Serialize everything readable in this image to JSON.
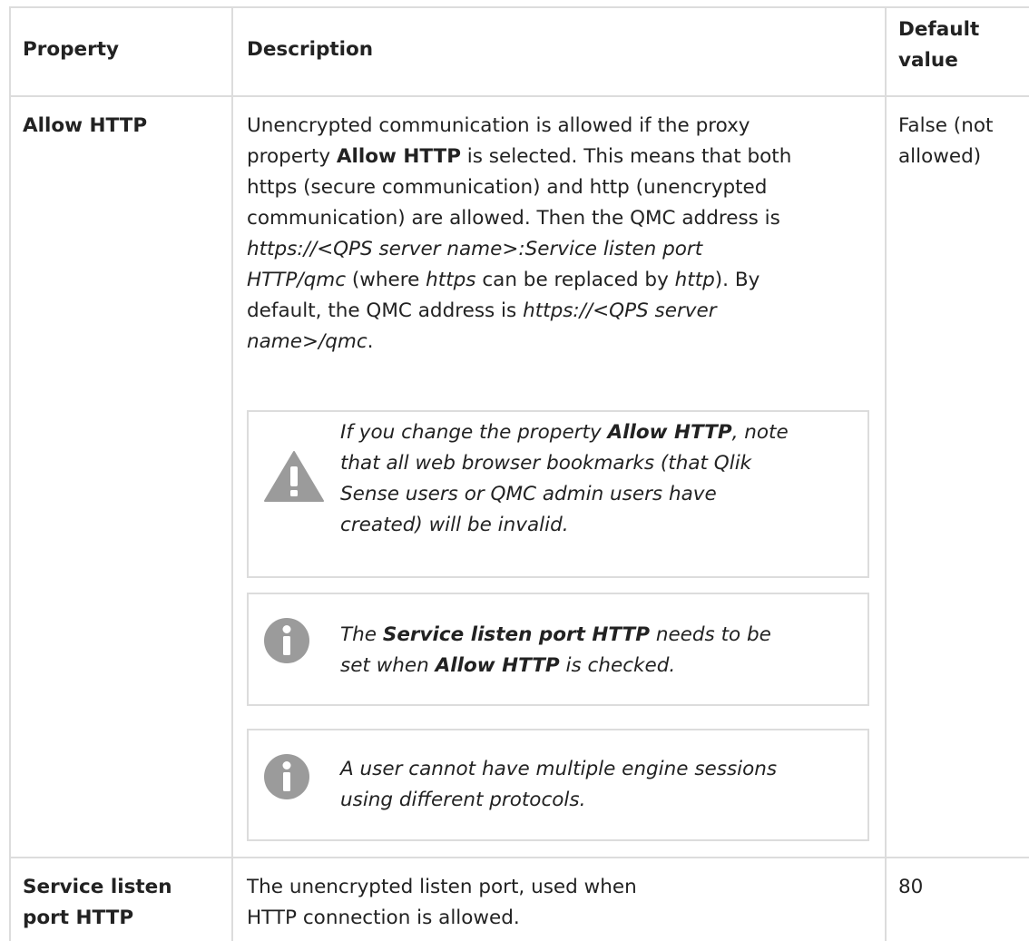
{
  "table": {
    "headers": {
      "property": "Property",
      "description": "Description",
      "default_line1": "Default",
      "default_line2": "value"
    },
    "rows": [
      {
        "property": "Allow HTTP",
        "description": {
          "l1": "Unencrypted communication is allowed if the proxy",
          "l2_a": "property ",
          "l2_b": "Allow HTTP",
          "l2_c": " is selected. This means that both",
          "l3": "https (secure communication) and http (unencrypted",
          "l4": "communication) are allowed. Then the QMC address is",
          "l5": "https://<QPS server name>:Service listen port",
          "l6_a": "HTTP/qmc",
          "l6_b": " (where ",
          "l6_c": "https",
          "l6_d": " can be replaced by ",
          "l6_e": "http",
          "l6_f": "). By",
          "l7_a": "default, the QMC address is ",
          "l7_b": "https://<QPS server",
          "l8_a": "name>/qmc",
          "l8_b": "."
        },
        "default_line1": "False (not",
        "default_line2": "allowed)",
        "notes": [
          {
            "icon": "warning-icon",
            "l1_a": "If you change the property ",
            "l1_b": "Allow HTTP",
            "l1_c": ", note",
            "l2": "that all web browser bookmarks (that Qlik",
            "l3": "Sense users or QMC admin users have",
            "l4": "created) will be invalid."
          },
          {
            "icon": "info-icon",
            "l1_a": "The ",
            "l1_b": "Service listen port HTTP",
            "l1_c": " needs to be",
            "l2_a": "set when ",
            "l2_b": "Allow HTTP",
            "l2_c": " is checked."
          },
          {
            "icon": "info-icon",
            "l1": "A user cannot have multiple engine sessions",
            "l2": "using different protocols."
          }
        ]
      },
      {
        "property_line1": "Service listen",
        "property_line2": "port HTTP",
        "description_line1": "The unencrypted listen port, used when",
        "description_line2": "HTTP connection is allowed.",
        "default": "80"
      }
    ],
    "colors": {
      "border": "#dcdcdc",
      "text": "#222222",
      "icon": "#9b9b9b"
    }
  }
}
